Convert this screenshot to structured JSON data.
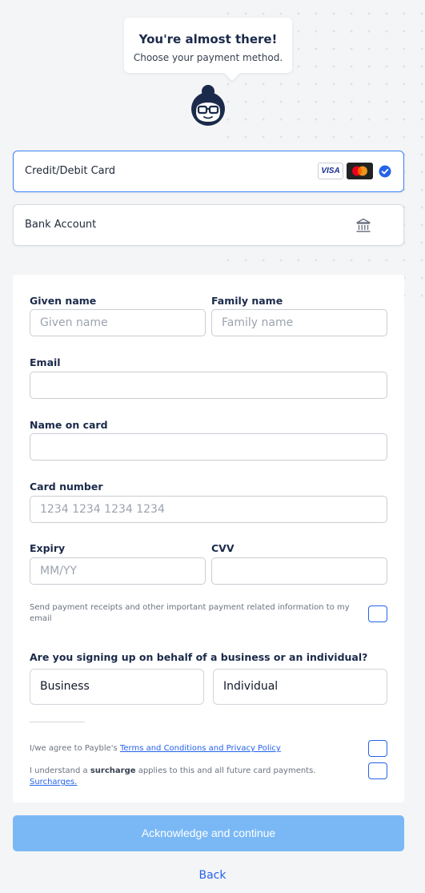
{
  "header": {
    "title": "You're almost there!",
    "subtitle": "Choose your payment method."
  },
  "payment_methods": [
    {
      "label": "Credit/Debit Card",
      "selected": true,
      "icons": [
        "visa-icon",
        "mastercard-icon",
        "check-circle-icon"
      ]
    },
    {
      "label": "Bank Account",
      "selected": false,
      "icons": [
        "bank-icon"
      ]
    }
  ],
  "card_brand_visa": "VISA",
  "form": {
    "given_name": {
      "label": "Given name",
      "placeholder": "Given name",
      "value": ""
    },
    "family_name": {
      "label": "Family name",
      "placeholder": "Family name",
      "value": ""
    },
    "email": {
      "label": "Email",
      "placeholder": "",
      "value": ""
    },
    "name_on_card": {
      "label": "Name on card",
      "placeholder": "",
      "value": ""
    },
    "card_number": {
      "label": "Card number",
      "placeholder": "1234 1234 1234 1234",
      "value": ""
    },
    "expiry": {
      "label": "Expiry",
      "placeholder": "MM/YY",
      "value": ""
    },
    "cvv": {
      "label": "CVV",
      "placeholder": "",
      "value": ""
    },
    "receipts_text": "Send payment receipts and other important payment related information to my email",
    "business_question": "Are you signing up on behalf of a business or an individual?",
    "options": [
      "Business",
      "Individual"
    ],
    "terms_prefix": "I/we agree to Payble's ",
    "terms_link": "Terms and Conditions and Privacy Policy",
    "surcharge_prefix": "I understand a ",
    "surcharge_bold": "surcharge",
    "surcharge_suffix": " applies to this and all future card payments. ",
    "surcharge_link": "Surcharges."
  },
  "actions": {
    "submit": "Acknowledge and continue",
    "back": "Back"
  },
  "colors": {
    "accent": "#2563eb",
    "submit_disabled": "#7ab8f5",
    "background": "#f4f5f7",
    "heading": "#1b2a4a"
  }
}
